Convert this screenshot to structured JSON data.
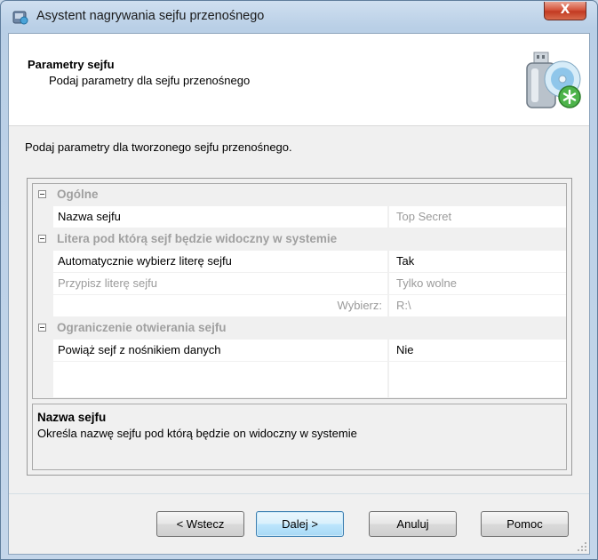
{
  "window": {
    "title": "Asystent nagrywania sejfu przenośnego",
    "close_label": "X"
  },
  "header": {
    "title": "Parametry sejfu",
    "subtitle": "Podaj parametry dla sejfu przenośnego",
    "icon": "usb-disc-add-icon"
  },
  "intro": "Podaj parametry dla tworzonego sejfu przenośnego.",
  "grid": {
    "categories": [
      {
        "label": "Ogólne"
      },
      {
        "label": "Litera pod którą sejf będzie widoczny w systemie"
      },
      {
        "label": "Ograniczenie otwierania sejfu"
      }
    ],
    "properties": [
      {
        "name": "Nazwa sejfu",
        "value": "Top Secret"
      },
      {
        "name": "Automatycznie wybierz literę sejfu",
        "value": "Tak"
      },
      {
        "name": "Przypisz literę sejfu",
        "value": "Tylko wolne"
      },
      {
        "name": "Wybierz:",
        "value": "R:\\"
      },
      {
        "name": "Powiąż sejf z nośnikiem danych",
        "value": "Nie"
      }
    ]
  },
  "description": {
    "title": "Nazwa sejfu",
    "text": "Określa nazwę sejfu pod którą będzie on widoczny w systemie"
  },
  "buttons": {
    "back": "< Wstecz",
    "next": "Dalej >",
    "cancel": "Anuluj",
    "help": "Pomoc"
  }
}
